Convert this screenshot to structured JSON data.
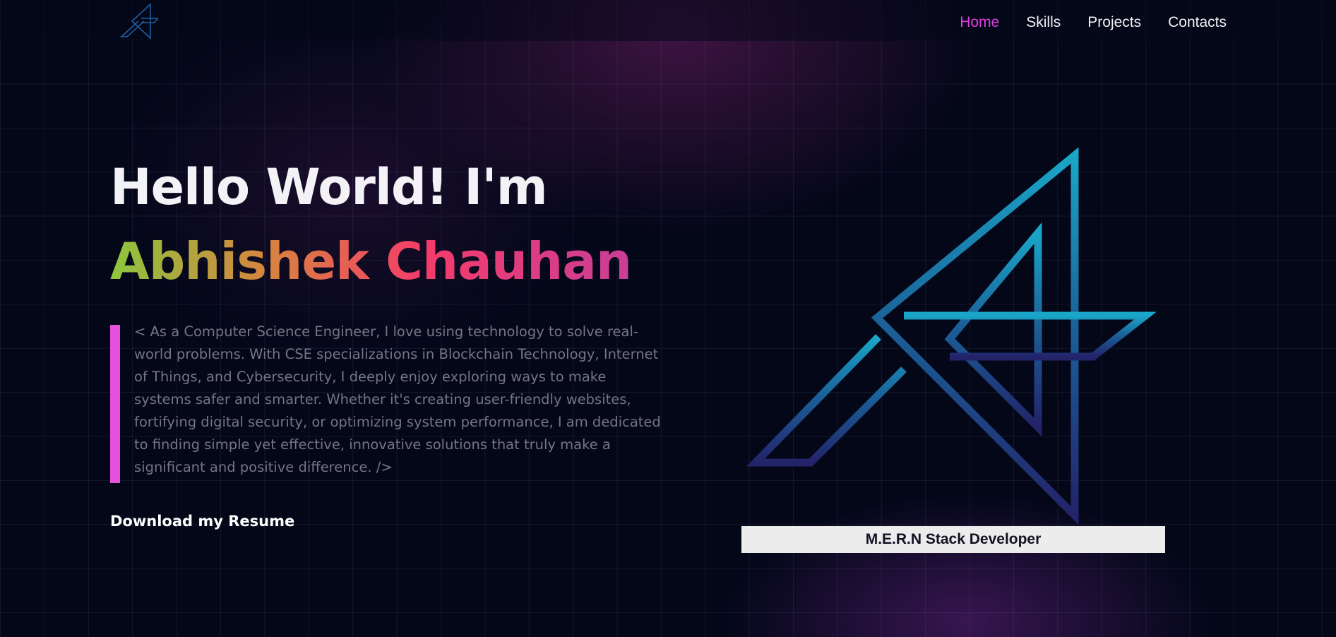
{
  "nav": {
    "links": [
      {
        "label": "Home",
        "active": true
      },
      {
        "label": "Skills",
        "active": false
      },
      {
        "label": "Projects",
        "active": false
      },
      {
        "label": "Contacts",
        "active": false
      }
    ]
  },
  "hero": {
    "greeting": "Hello World! I'm",
    "name": "Abhishek Chauhan",
    "about": "< As a Computer Science Engineer, I love using technology to solve real-world problems. With CSE specializations in Blockchain Technology, Internet of Things, and Cybersecurity, I deeply enjoy exploring ways to make systems safer and smarter. Whether it's creating user-friendly websites, fortifying digital security, or optimizing system performance, I am dedicated to finding simple yet effective, innovative solutions that truly make a significant and positive difference. />",
    "resume_label": "Download my Resume"
  },
  "role": {
    "label": "M.E.R.N Stack Developer"
  },
  "colors": {
    "accent": "#e33fde",
    "background": "#030718",
    "logo_top": "#1aa6c8",
    "logo_bottom": "#23236a"
  }
}
